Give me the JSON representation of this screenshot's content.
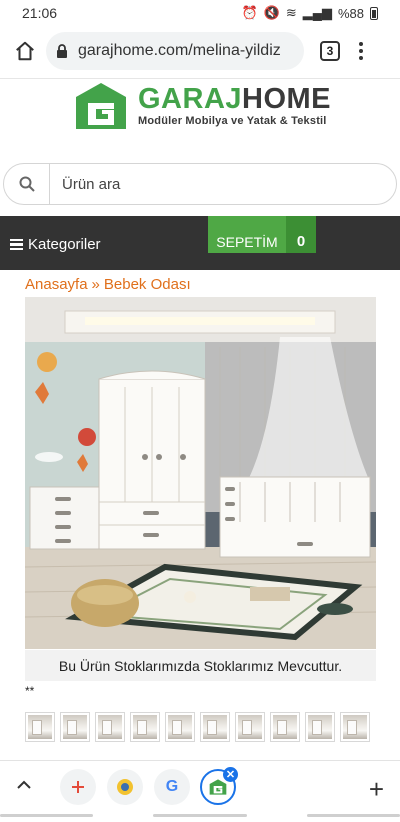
{
  "status_bar": {
    "time": "21:06",
    "battery": "%88"
  },
  "browser": {
    "url": "garajhome.com/melina-yildiz",
    "tab_count": "3"
  },
  "site": {
    "logo_name_green": "GARAJ",
    "logo_name_dark": "HOME",
    "logo_tagline": "Modüler Mobilya ve Yatak & Tekstil"
  },
  "search": {
    "placeholder": "Ürün ara"
  },
  "nav": {
    "categories_label": "Kategoriler",
    "cart_label": "SEPETİM",
    "cart_count": "0"
  },
  "breadcrumb": {
    "home": "Anasayfa",
    "separator": "»",
    "current": "Bebek Odası"
  },
  "product": {
    "stock_notice": "Bu Ürün Stoklarımızda Stoklarımız Mevcuttur.",
    "rating_marks": "**",
    "thumbnail_count": 10
  },
  "colors": {
    "brand_green": "#43a34a",
    "breadcrumb_orange": "#e0701c",
    "nav_dark": "#333333",
    "accent_blue": "#1a73e8"
  },
  "bottom_bar": {
    "tabs": [
      "new-tab-plus",
      "site-tab",
      "google-tab",
      "garajhome-tab"
    ]
  }
}
